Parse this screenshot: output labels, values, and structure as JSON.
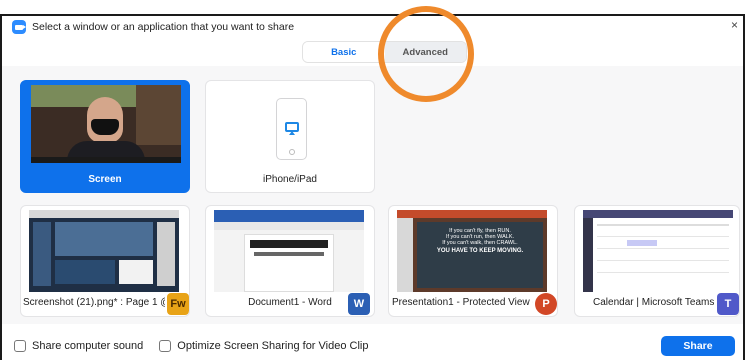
{
  "window": {
    "title": "Select a window or an application that you want to share",
    "close_glyph": "×"
  },
  "tabs": [
    {
      "label": "Basic",
      "active": true
    },
    {
      "label": "Advanced",
      "active": false
    }
  ],
  "sources": [
    {
      "label": "Screen",
      "selected": true
    },
    {
      "label": "iPhone/iPad",
      "selected": false
    },
    {
      "label": "Screenshot (21).png* : Page 1 @ ...",
      "app_icon": "Fw",
      "selected": false
    },
    {
      "label": "Document1 - Word",
      "app_icon": "W",
      "selected": false
    },
    {
      "label": "Presentation1 -  Protected View -...",
      "app_icon": "P",
      "selected": false
    },
    {
      "label": "Calendar | Microsoft Teams",
      "app_icon": "T",
      "selected": false
    }
  ],
  "slide_text": {
    "line1": "If you can't fly, then RUN.",
    "line2": "If you can't run, then WALK.",
    "line3": "If you can't walk, then CRAWL.",
    "line4": "YOU HAVE TO KEEP MOVING."
  },
  "options": {
    "share_sound_label": "Share computer sound",
    "optimize_label": "Optimize Screen Sharing for Video Clip"
  },
  "share_button_label": "Share",
  "colors": {
    "accent": "#0e71eb",
    "annotation": "#ef8a2c",
    "fw_badge": "#e8a317",
    "word_badge": "#2b5fb4",
    "ppt_badge": "#d24726",
    "teams_badge": "#5059c9"
  }
}
